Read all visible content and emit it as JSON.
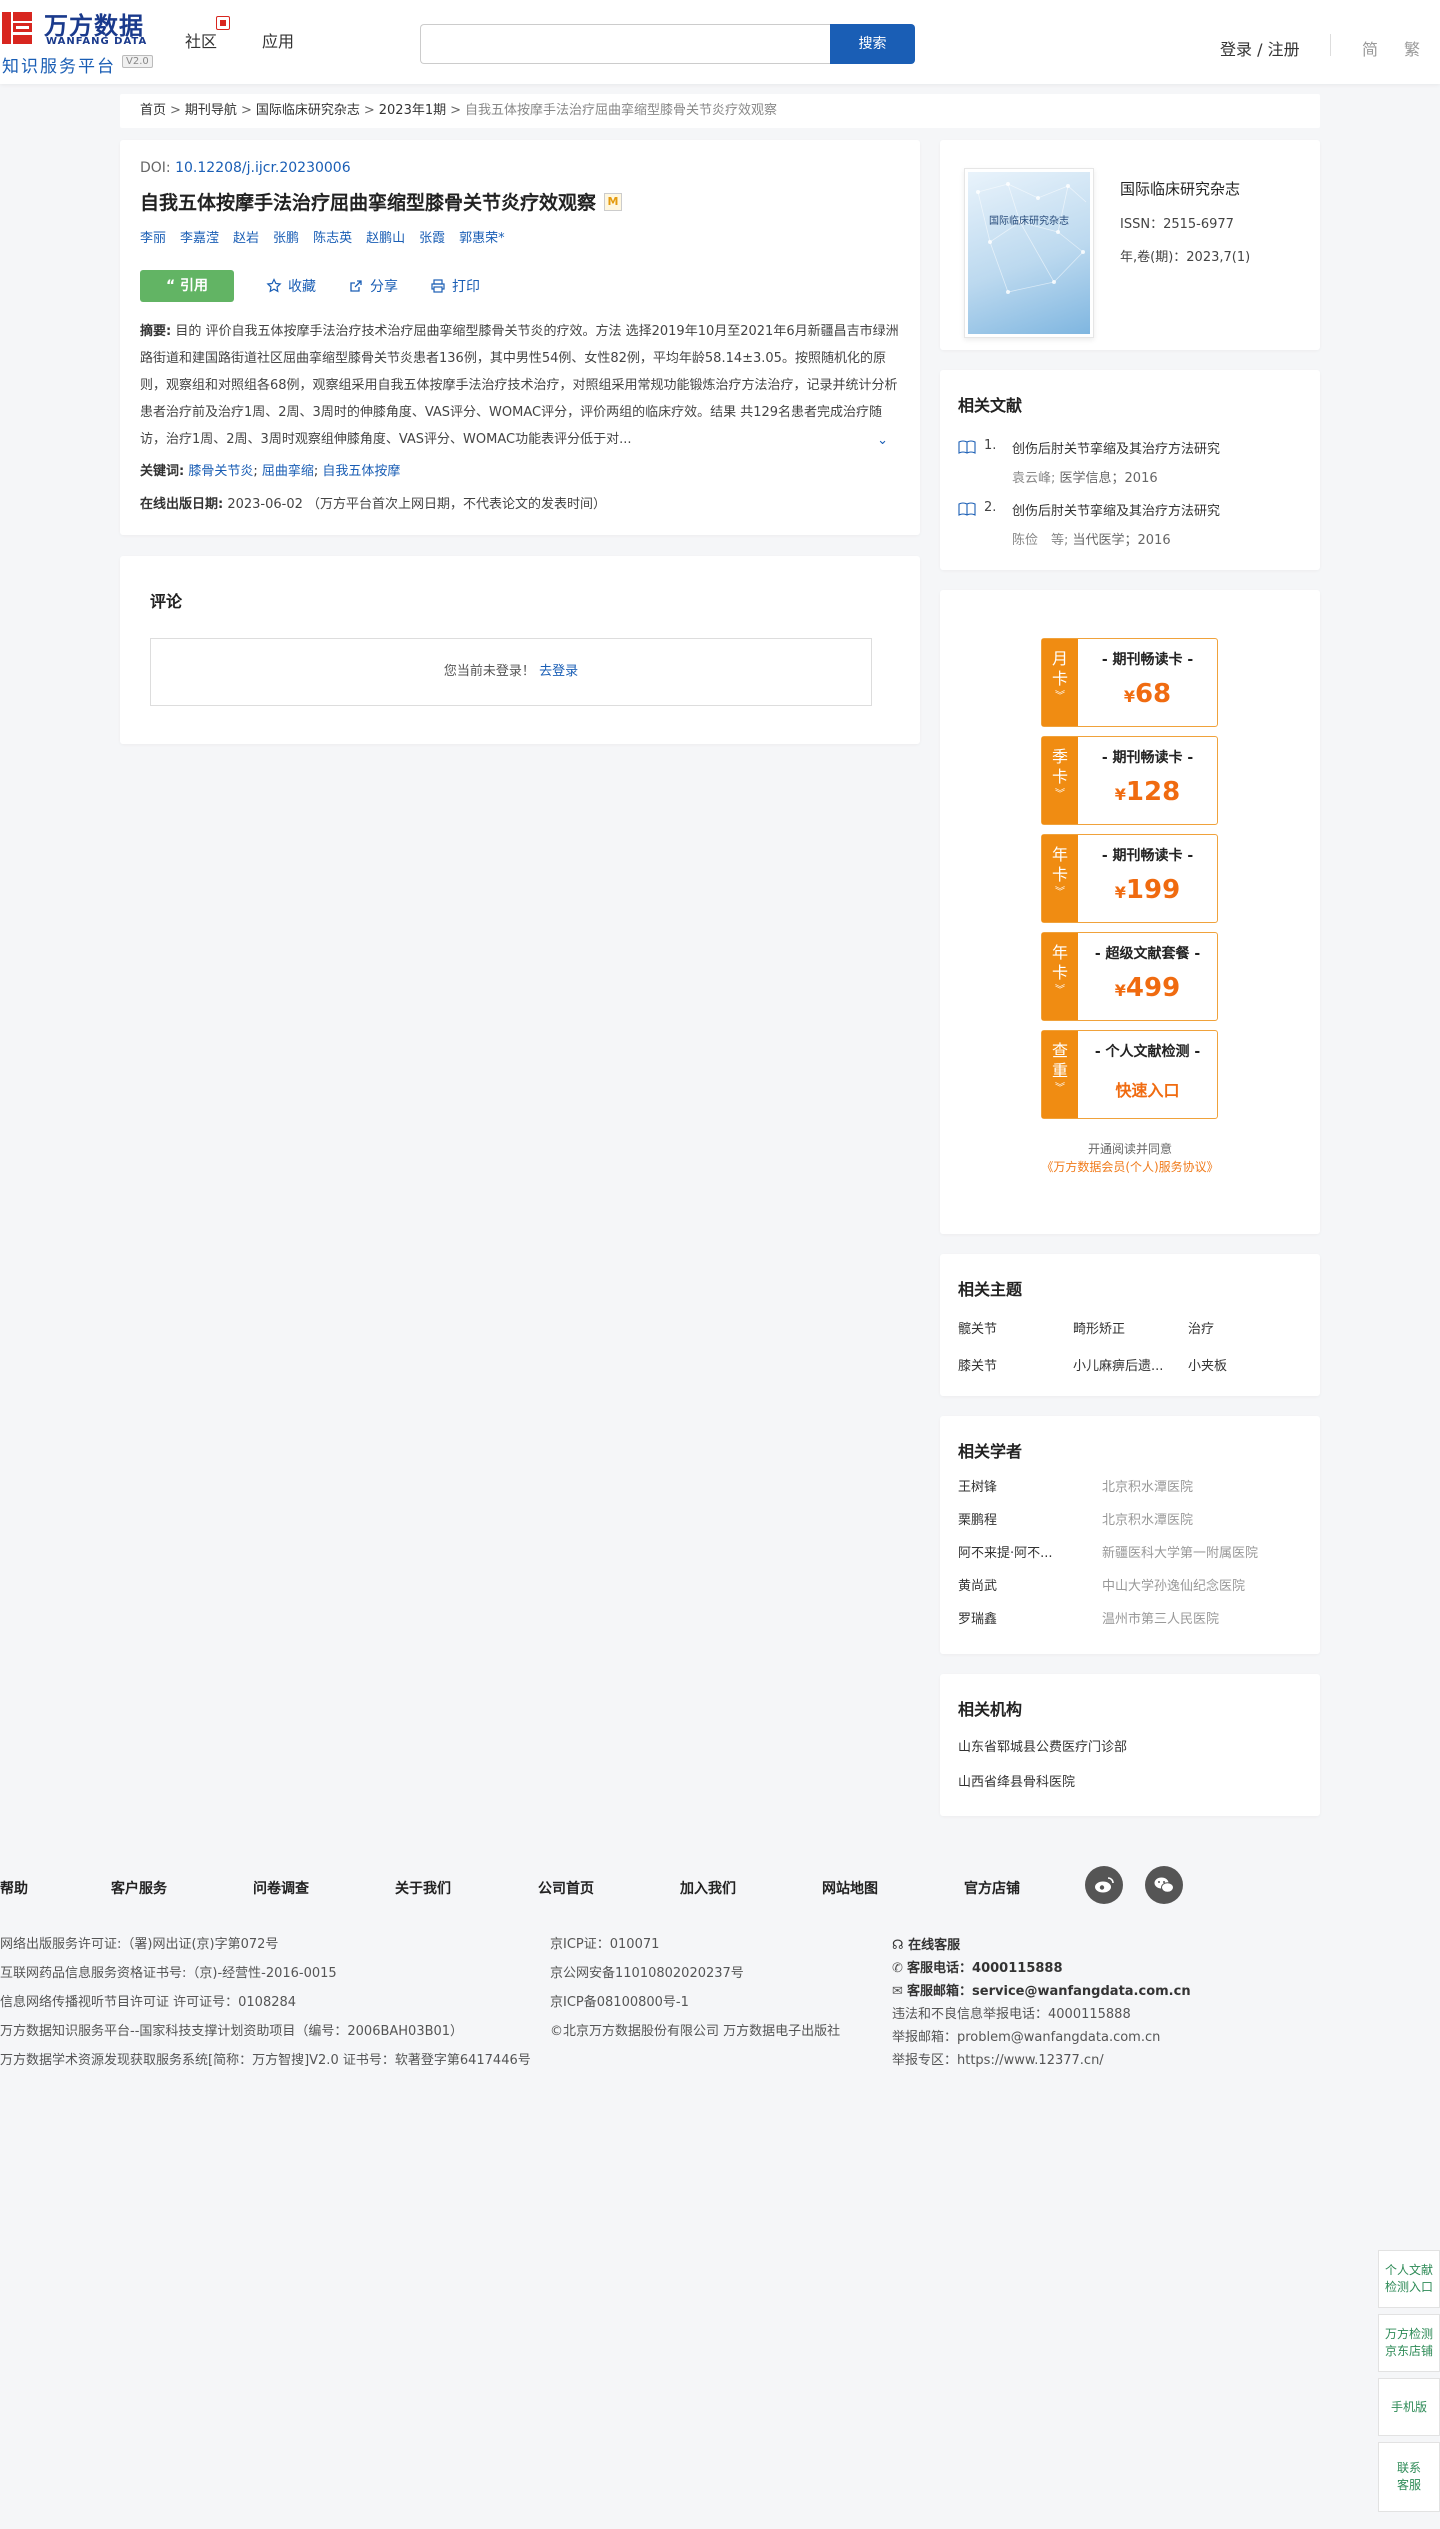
{
  "header": {
    "logo_cn": "万方数据",
    "logo_en": "WANFANG DATA",
    "logo_sub": "知识服务平台",
    "logo_ver": "V2.0",
    "nav": [
      "社区",
      "应用"
    ],
    "search_placeholder": "",
    "search_btn": "搜索",
    "login": "登录 / 注册",
    "lang": [
      "简",
      "繁"
    ]
  },
  "breadcrumb": {
    "items": [
      "首页",
      "期刊导航",
      "国际临床研究杂志",
      "2023年1期"
    ],
    "current": "自我五体按摩手法治疗屈曲挛缩型膝骨关节炎疗效观察"
  },
  "article": {
    "doi_label": "DOI:",
    "doi": "10.12208/j.ijcr.20230006",
    "title": "自我五体按摩手法治疗屈曲挛缩型膝骨关节炎疗效观察",
    "m_badge": "M",
    "authors": [
      "李丽",
      "李嘉滢",
      "赵岩",
      "张鹏",
      "陈志英",
      "赵鹏山",
      "张霞",
      "郭惠荣*"
    ],
    "actions": {
      "cite": "引用",
      "favorite": "收藏",
      "share": "分享",
      "print": "打印"
    },
    "abstract_label": "摘要:",
    "abstract": "目的 评价自我五体按摩手法治疗技术治疗屈曲挛缩型膝骨关节炎的疗效。方法 选择2019年10月至2021年6月新疆昌吉市绿洲路街道和建国路街道社区屈曲挛缩型膝骨关节炎患者136例，其中男性54例、女性82例，平均年龄58.14±3.05。按照随机化的原则，观察组和对照组各68例，观察组采用自我五体按摩手法治疗技术治疗，对照组采用常规功能锻炼治疗方法治疗，记录并统计分析患者治疗前及治疗1周、2周、3周时的伸膝角度、VAS评分、WOMAC评分，评价两组的临床疗效。结果 共129名患者完成治疗随访，治疗1周、2周、3周时观察组伸膝角度、VAS评分、WOMAC功能表评分低于对...",
    "keywords_label": "关键词:",
    "keywords": [
      "膝骨关节炎",
      "屈曲挛缩",
      "自我五体按摩"
    ],
    "pubdate_label": "在线出版日期:",
    "pubdate": "2023-06-02",
    "pubdate_note": "（万方平台首次上网日期，不代表论文的发表时间）"
  },
  "comments": {
    "title": "评论",
    "not_logged": "您当前未登录！",
    "login_link": "去登录"
  },
  "journal": {
    "cover_title": "国际临床研究杂志",
    "name": "国际临床研究杂志",
    "issn": "ISSN：2515-6977",
    "volume": "年,卷(期)：2023,7(1)"
  },
  "related_docs": {
    "title": "相关文献",
    "items": [
      {
        "num": "1.",
        "title": "创伤后肘关节挛缩及其治疗方法研究",
        "author": "袁云峰;",
        "source": "医学信息；2016"
      },
      {
        "num": "2.",
        "title": "创伤后肘关节挛缩及其治疗方法研究",
        "author": "陈俭　等;",
        "source": "当代医学；2016"
      }
    ]
  },
  "promo": {
    "cards": [
      {
        "side": "月卡",
        "label": "- 期刊畅读卡 -",
        "yen": "¥",
        "price": "68"
      },
      {
        "side": "季卡",
        "label": "- 期刊畅读卡 -",
        "yen": "¥",
        "price": "128"
      },
      {
        "side": "年卡",
        "label": "- 期刊畅读卡 -",
        "yen": "¥",
        "price": "199"
      },
      {
        "side": "年卡",
        "label": "- 超级文献套餐 -",
        "yen": "¥",
        "price": "499"
      },
      {
        "side": "查重",
        "label": "- 个人文献检测 -",
        "link": "快速入口"
      }
    ],
    "note": "开通阅读并同意",
    "agreement": "《万方数据会员(个人)服务协议》"
  },
  "topics": {
    "title": "相关主题",
    "items": [
      "髋关节",
      "畸形矫正",
      "治疗",
      "膝关节",
      "小儿麻痹后遗...",
      "小夹板"
    ]
  },
  "scholars": {
    "title": "相关学者",
    "items": [
      {
        "name": "王树锋",
        "org": "北京积水潭医院"
      },
      {
        "name": "栗鹏程",
        "org": "北京积水潭医院"
      },
      {
        "name": "阿不来提·阿不...",
        "org": "新疆医科大学第一附属医院"
      },
      {
        "name": "黄尚武",
        "org": "中山大学孙逸仙纪念医院"
      },
      {
        "name": "罗瑞鑫",
        "org": "温州市第三人民医院"
      }
    ]
  },
  "institutions": {
    "title": "相关机构",
    "items": [
      "山东省郓城县公费医疗门诊部",
      "山西省绛县骨科医院"
    ]
  },
  "footer": {
    "links": [
      "帮助",
      "客户服务",
      "问卷调查",
      "关于我们",
      "公司首页",
      "加入我们",
      "网站地图",
      "官方店铺"
    ],
    "col1": [
      "网络出版服务许可证:（署)网出证(京)字第072号",
      "互联网药品信息服务资格证书号:（京)-经营性-2016-0015",
      "信息网络传播视听节目许可证 许可证号：0108284",
      "万方数据知识服务平台--国家科技支撑计划资助项目（编号：2006BAH03B01）",
      "万方数据学术资源发现获取服务系统[简称：万方智搜]V2.0 证书号：软著登字第6417446号"
    ],
    "col2": [
      "京ICP证：010071",
      "京公网安备11010802020237号",
      "京ICP备08100800号-1",
      "©北京万方数据股份有限公司 万方数据电子出版社"
    ],
    "col3": {
      "online": "在线客服",
      "phone_label": "客服电话：",
      "phone": "4000115888",
      "email_label": "客服邮箱：",
      "email": "service@wanfangdata.com.cn",
      "report_phone": "违法和不良信息举报电话：4000115888",
      "report_email": "举报邮箱：problem@wanfangdata.com.cn",
      "report_zone": "举报专区：https://www.12377.cn/"
    }
  },
  "floating": {
    "personal": "个人文献检测入口",
    "jd": "万方检测京东店铺",
    "mobile": "手机版",
    "contact": "联系客服"
  }
}
